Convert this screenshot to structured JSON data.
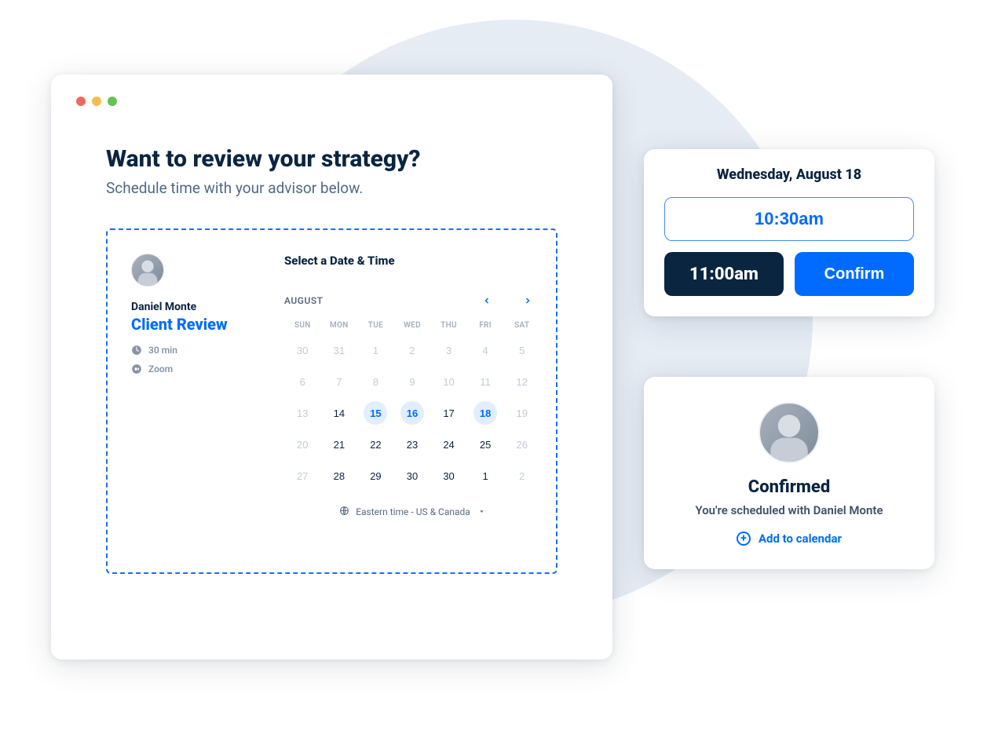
{
  "header": {
    "title": "Want to review your strategy?",
    "subtitle": "Schedule time with your advisor below."
  },
  "advisor": {
    "name": "Daniel Monte",
    "event_title": "Client Review",
    "duration": "30 min",
    "location": "Zoom"
  },
  "calendar": {
    "title": "Select a Date & Time",
    "month_label": "AUGUST",
    "dow": [
      "SUN",
      "MON",
      "TUE",
      "WED",
      "THU",
      "FRI",
      "SAT"
    ],
    "weeks": [
      [
        {
          "n": "30",
          "state": "muted"
        },
        {
          "n": "31",
          "state": "muted"
        },
        {
          "n": "1",
          "state": "muted"
        },
        {
          "n": "2",
          "state": "muted"
        },
        {
          "n": "3",
          "state": "muted"
        },
        {
          "n": "4",
          "state": "muted"
        },
        {
          "n": "5",
          "state": "muted"
        }
      ],
      [
        {
          "n": "6",
          "state": "muted"
        },
        {
          "n": "7",
          "state": "muted"
        },
        {
          "n": "8",
          "state": "muted"
        },
        {
          "n": "9",
          "state": "muted"
        },
        {
          "n": "10",
          "state": "muted"
        },
        {
          "n": "11",
          "state": "muted"
        },
        {
          "n": "12",
          "state": "muted"
        }
      ],
      [
        {
          "n": "13",
          "state": "muted"
        },
        {
          "n": "14",
          "state": "normal"
        },
        {
          "n": "15",
          "state": "available"
        },
        {
          "n": "16",
          "state": "available"
        },
        {
          "n": "17",
          "state": "normal"
        },
        {
          "n": "18",
          "state": "available"
        },
        {
          "n": "19",
          "state": "muted"
        }
      ],
      [
        {
          "n": "20",
          "state": "muted"
        },
        {
          "n": "21",
          "state": "normal"
        },
        {
          "n": "22",
          "state": "normal"
        },
        {
          "n": "23",
          "state": "normal"
        },
        {
          "n": "24",
          "state": "normal"
        },
        {
          "n": "25",
          "state": "normal"
        },
        {
          "n": "26",
          "state": "muted"
        }
      ],
      [
        {
          "n": "27",
          "state": "muted"
        },
        {
          "n": "28",
          "state": "normal"
        },
        {
          "n": "29",
          "state": "normal"
        },
        {
          "n": "30",
          "state": "normal"
        },
        {
          "n": "30",
          "state": "normal"
        },
        {
          "n": "1",
          "state": "normal"
        },
        {
          "n": "2",
          "state": "muted"
        }
      ]
    ],
    "timezone": "Eastern time - US & Canada"
  },
  "timepicker": {
    "date_label": "Wednesday, August 18",
    "open_slot": "10:30am",
    "selected_slot": "11:00am",
    "confirm_label": "Confirm"
  },
  "confirmation": {
    "title": "Confirmed",
    "subtitle": "You're scheduled with Daniel Monte",
    "add_to_calendar": "Add to calendar"
  }
}
